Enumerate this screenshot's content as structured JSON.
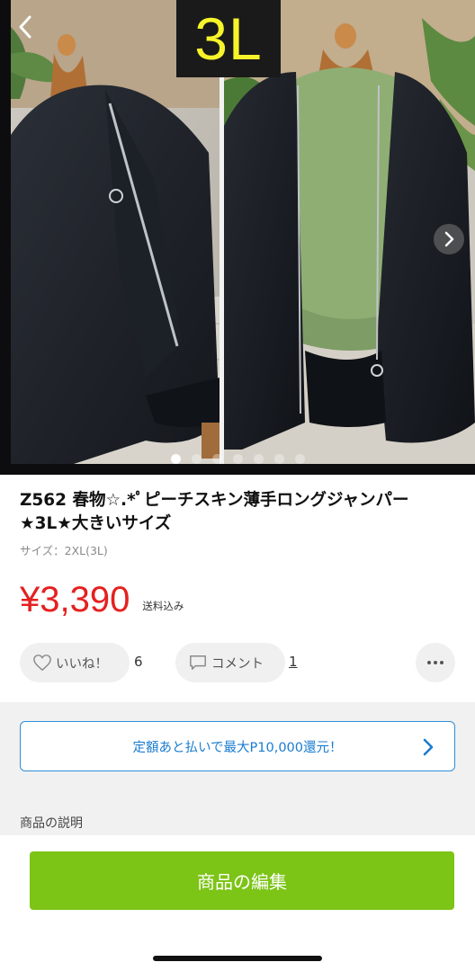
{
  "carousel": {
    "size_badge": "3L",
    "image_count": 7,
    "active_index": 0,
    "back_icon": "chevron-left-icon",
    "next_icon": "chevron-right-icon",
    "badge_color": "#f7f52a"
  },
  "product": {
    "title": "Z562 春物☆.*ﾟピーチスキン薄手ロングジャンパー★3L★大きいサイズ",
    "size": "サイズ：2XL(3L)",
    "price": "¥3,390",
    "shipping": "送料込み",
    "price_color": "#e52020"
  },
  "actions": {
    "like_label": "いいね！",
    "like_count": "6",
    "comment_label": "コメント",
    "comment_count": "1",
    "more_icon": "more-horizontal-icon"
  },
  "banner": {
    "text": "定額あと払いで最大P10,000還元！",
    "accent": "#1a7cd1"
  },
  "description": {
    "section_title": "商品の説明"
  },
  "bottom": {
    "edit_label": "商品の編集",
    "button_color": "#7cc416"
  }
}
